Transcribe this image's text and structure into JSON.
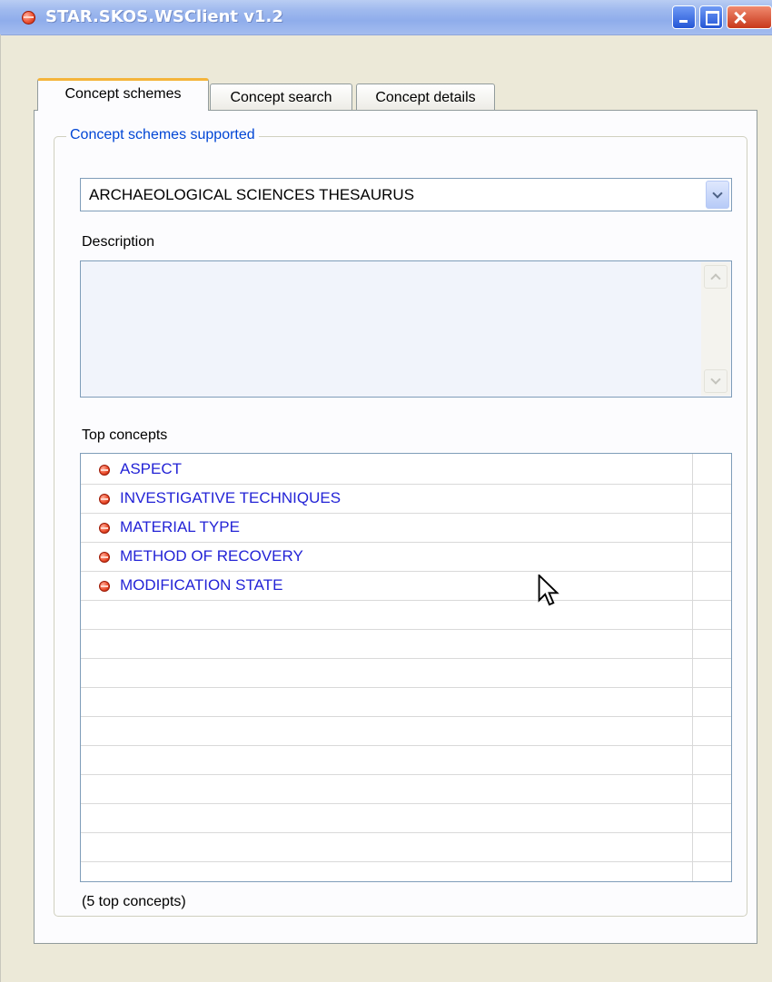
{
  "window": {
    "title": "STAR.SKOS.WSClient v1.2",
    "icons": {
      "app": "red-dot-icon",
      "minimize": "minimize-icon",
      "maximize": "maximize-icon",
      "close": "close-icon"
    }
  },
  "tabs": [
    {
      "label": "Concept schemes",
      "active": true
    },
    {
      "label": "Concept search",
      "active": false
    },
    {
      "label": "Concept details",
      "active": false
    }
  ],
  "schemes_group": {
    "legend": "Concept schemes supported",
    "selected_scheme": "ARCHAEOLOGICAL SCIENCES THESAURUS",
    "description_label": "Description",
    "description_value": "",
    "top_concepts_label": "Top concepts",
    "top_concepts": [
      {
        "label": "ASPECT",
        "icon": "red-dot-icon"
      },
      {
        "label": "INVESTIGATIVE TECHNIQUES",
        "icon": "red-dot-icon"
      },
      {
        "label": "MATERIAL TYPE",
        "icon": "red-dot-icon"
      },
      {
        "label": "METHOD OF RECOVERY",
        "icon": "red-dot-icon"
      },
      {
        "label": "MODIFICATION STATE",
        "icon": "red-dot-icon"
      }
    ],
    "count_text": "(5 top concepts)"
  },
  "colors": {
    "titlebar": "#9fb9ee",
    "legend_text": "#0046d5",
    "concept_text": "#2323d6",
    "active_tab_accent": "#f4b43a",
    "bullet": "#ec4f2e"
  }
}
